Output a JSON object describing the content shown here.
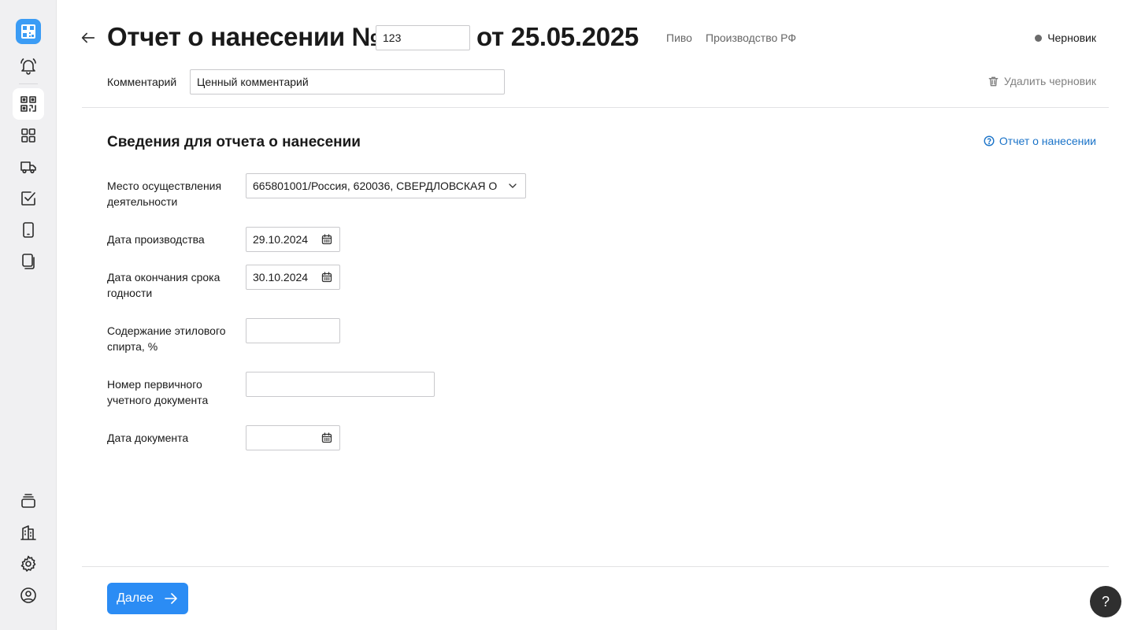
{
  "header": {
    "title": "Отчет о нанесении №",
    "report_number": "123",
    "date_text": "от 25.05.2025",
    "tags": [
      "Пиво",
      "Производство РФ"
    ],
    "status": "Черновик",
    "status_color": "#6b6b6b"
  },
  "comment": {
    "label": "Комментарий",
    "value": "Ценный комментарий",
    "delete_label": "Удалить черновик"
  },
  "section": {
    "title": "Сведения для отчета о нанесении",
    "help_link": "Отчет о нанесении"
  },
  "form": {
    "fields": [
      {
        "label": "Место осуществления деятельности",
        "value": "665801001/Россия, 620036, СВЕРДЛОВСКАЯ О",
        "type": "select",
        "icon": "chevron-down-icon"
      },
      {
        "label": "Дата производства",
        "value": "29.10.2024",
        "type": "date",
        "icon": "calendar-icon"
      },
      {
        "label": "Дата окончания срока годности",
        "value": "30.10.2024",
        "type": "date",
        "icon": "calendar-icon"
      },
      {
        "label": "Содержание этилового спирта, %",
        "value": "",
        "type": "text"
      },
      {
        "label": "Номер первичного учетного документа",
        "value": "",
        "type": "text"
      },
      {
        "label": "Дата документа",
        "value": "",
        "type": "date",
        "icon": "calendar-icon"
      }
    ]
  },
  "footer": {
    "next_label": "Далее",
    "help_fab": "?"
  },
  "sidebar": {
    "items": [
      "logo",
      "bell-icon",
      "qr-code-icon",
      "grid-icon",
      "truck-icon",
      "check-square-icon",
      "tablet-icon",
      "documents-icon",
      "layers-icon",
      "buildings-icon",
      "gear-icon",
      "user-circle-icon"
    ],
    "active": "qr-code-icon"
  },
  "colors": {
    "accent": "#2b8cf4",
    "link": "#1a73c8",
    "sidebar_bg": "#f0f0f2"
  }
}
